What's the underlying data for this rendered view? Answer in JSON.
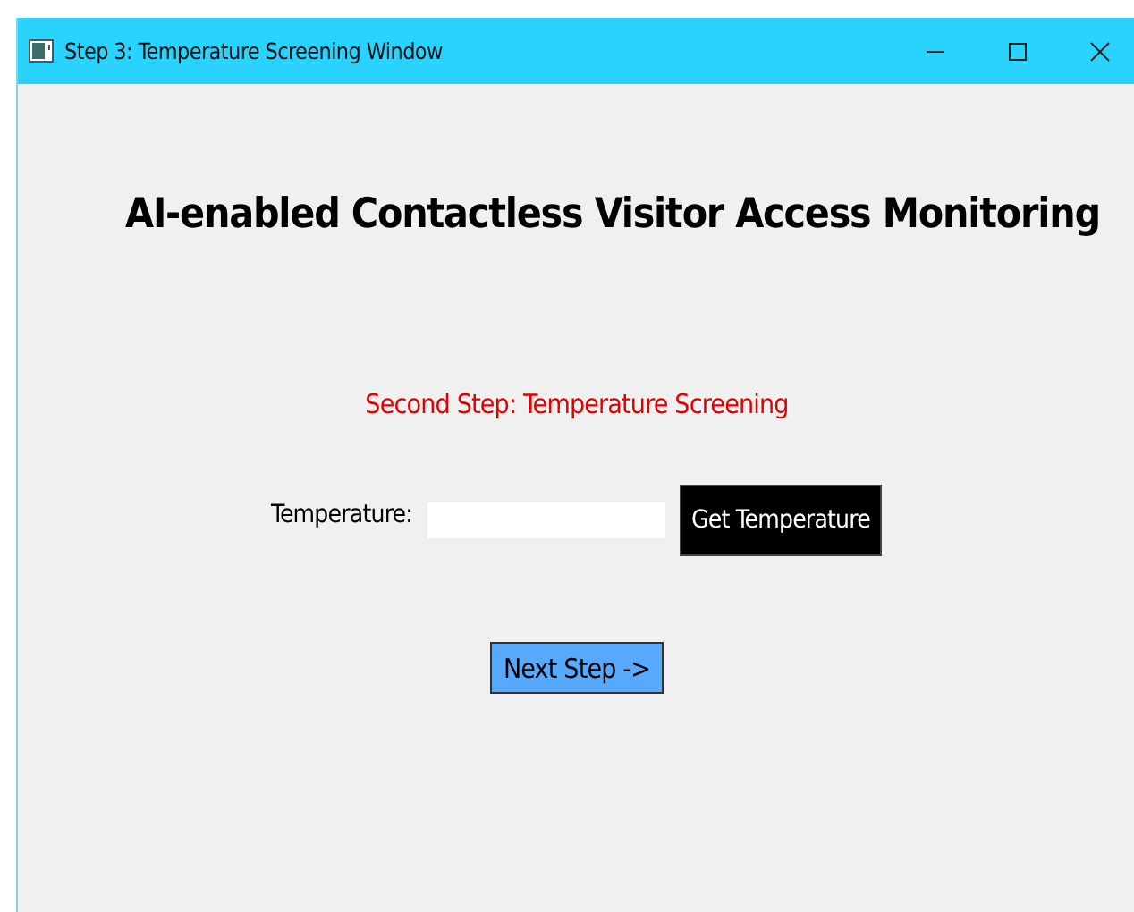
{
  "window": {
    "title": "Step 3: Temperature Screening Window"
  },
  "heading": "AI-enabled Contactless Visitor Access Monitoring",
  "subtitle": "Second Step: Temperature Screening",
  "temperature": {
    "label": "Temperature:",
    "button": "Get Temperature"
  },
  "next_button": "Next Step ->"
}
